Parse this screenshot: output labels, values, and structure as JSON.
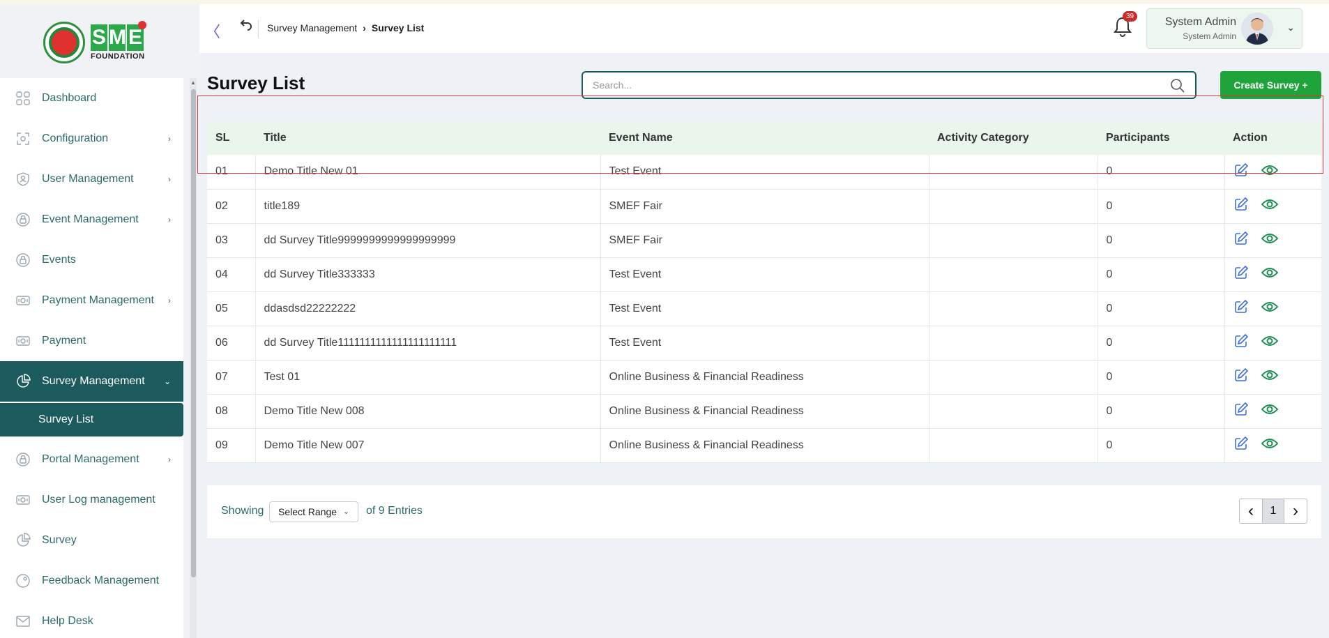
{
  "brand": {
    "logo_letters": [
      "S",
      "M",
      "E"
    ],
    "logo_sub": "FOUNDATION"
  },
  "sidebar": {
    "items": [
      {
        "label": "Dashboard",
        "icon": "grid-icon",
        "chevron": ""
      },
      {
        "label": "Configuration",
        "icon": "config-icon",
        "chevron": "›"
      },
      {
        "label": "User Management",
        "icon": "user-shield-icon",
        "chevron": "›"
      },
      {
        "label": "Event Management",
        "icon": "lock-circle-icon",
        "chevron": "›"
      },
      {
        "label": "Events",
        "icon": "lock-circle-icon",
        "chevron": ""
      },
      {
        "label": "Payment Management",
        "icon": "money-icon",
        "chevron": "›"
      },
      {
        "label": "Payment",
        "icon": "money-icon",
        "chevron": ""
      },
      {
        "label": "Survey Management",
        "icon": "pie-icon",
        "chevron": "⌄",
        "active": true
      },
      {
        "label": "Portal Management",
        "icon": "lock-circle-icon",
        "chevron": "›"
      },
      {
        "label": "User Log management",
        "icon": "money-icon",
        "chevron": ""
      },
      {
        "label": "Survey",
        "icon": "pie-icon",
        "chevron": ""
      },
      {
        "label": "Feedback Management",
        "icon": "feedback-icon",
        "chevron": ""
      },
      {
        "label": "Help Desk",
        "icon": "mail-icon",
        "chevron": ""
      }
    ],
    "submenu_label": "Survey List"
  },
  "header": {
    "breadcrumb_parent": "Survey Management",
    "breadcrumb_sep": "›",
    "breadcrumb_current": "Survey List",
    "notification_count": "39",
    "user_name": "System Admin",
    "user_role": "System Admin"
  },
  "page": {
    "title": "Survey List",
    "search_placeholder": "Search...",
    "create_label": "Create Survey +"
  },
  "table": {
    "columns": [
      "SL",
      "Title",
      "Event Name",
      "Activity Category",
      "Participants",
      "Action"
    ],
    "rows": [
      {
        "sl": "01",
        "title": "Demo Title New 01",
        "event": "Test Event",
        "category": "",
        "participants": "0"
      },
      {
        "sl": "02",
        "title": "title189",
        "event": "SMEF Fair",
        "category": "",
        "participants": "0"
      },
      {
        "sl": "03",
        "title": "dd Survey Title9999999999999999999",
        "event": "SMEF Fair",
        "category": "",
        "participants": "0"
      },
      {
        "sl": "04",
        "title": "dd Survey Title333333",
        "event": "Test Event",
        "category": "",
        "participants": "0"
      },
      {
        "sl": "05",
        "title": "ddasdsd22222222",
        "event": "Test Event",
        "category": "",
        "participants": "0"
      },
      {
        "sl": "06",
        "title": "dd Survey Title1111111111111111111111",
        "event": "Test Event",
        "category": "",
        "participants": "0"
      },
      {
        "sl": "07",
        "title": "Test 01",
        "event": "Online Business & Financial Readiness",
        "category": "",
        "participants": "0"
      },
      {
        "sl": "08",
        "title": "Demo Title New 008",
        "event": "Online Business & Financial Readiness",
        "category": "",
        "participants": "0"
      },
      {
        "sl": "09",
        "title": "Demo Title New 007",
        "event": "Online Business & Financial Readiness",
        "category": "",
        "participants": "0"
      }
    ]
  },
  "pagination": {
    "showing_label": "Showing",
    "range_label": "Select Range",
    "entries_label": "of 9 Entries",
    "current_page": "1",
    "prev": "‹",
    "next": "›"
  },
  "colors": {
    "primary": "#1c5b5d",
    "accent_green": "#1fa33b",
    "header_row": "#eaf6ec",
    "badge": "#c92a2a"
  }
}
